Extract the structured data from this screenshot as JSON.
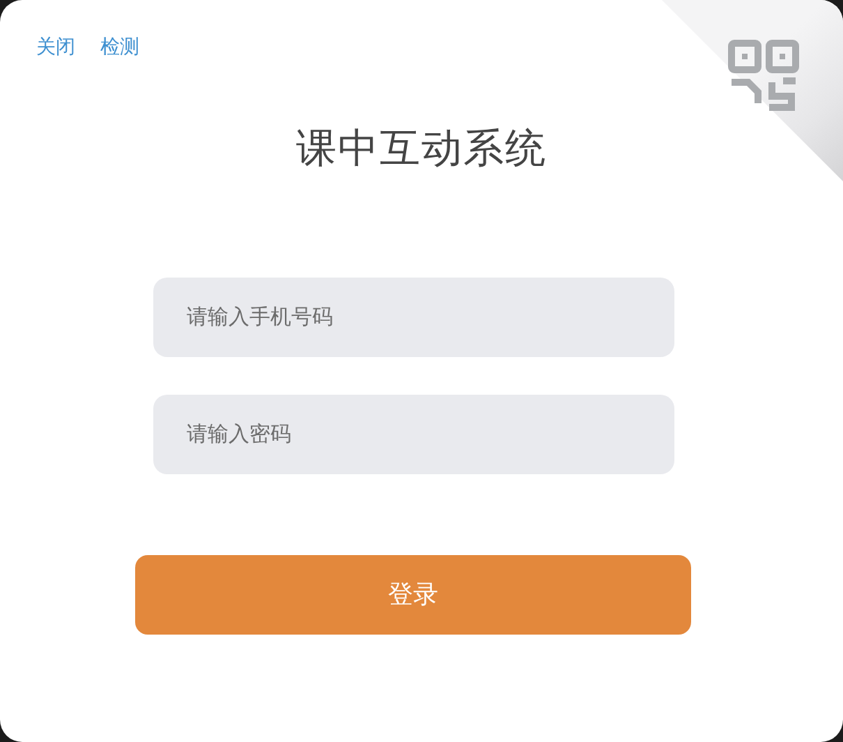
{
  "top_links": [
    {
      "label": "关闭"
    },
    {
      "label": "检测"
    }
  ],
  "title": "课中互动系统",
  "fields": [
    {
      "placeholder": "请输入手机号码"
    },
    {
      "placeholder": "请输入密码"
    }
  ],
  "login_button": {
    "label": "登录"
  }
}
